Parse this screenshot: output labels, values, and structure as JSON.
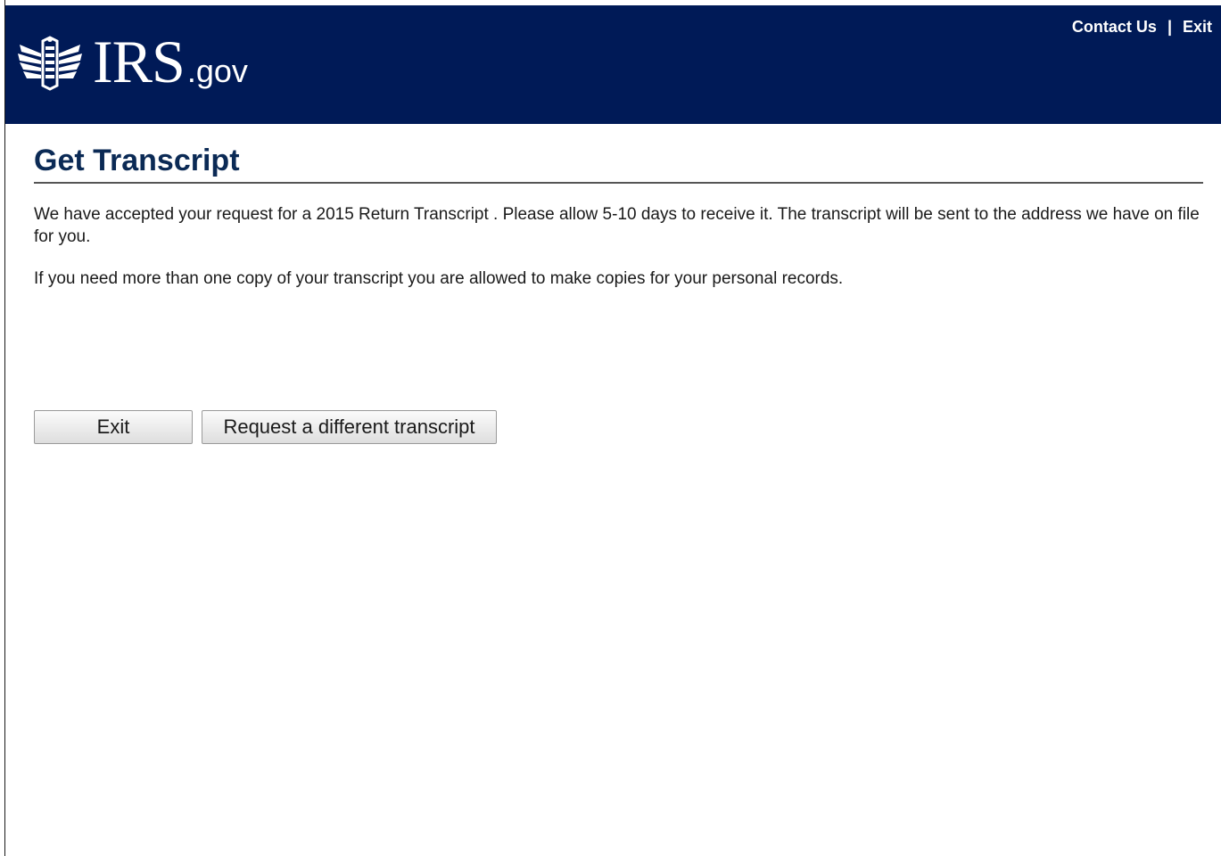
{
  "header": {
    "logo_text": "IRS",
    "logo_suffix": ".gov",
    "logo_icon": "irs-eagle-seal-icon",
    "contact_link": "Contact Us",
    "separator": "|",
    "exit_link": "Exit",
    "background_color": "#001a57"
  },
  "main": {
    "title": "Get Transcript",
    "paragraph1": "We have accepted your request for a 2015 Return Transcript . Please allow 5-10 days to receive it. The transcript will be sent to the address we have on file for you.",
    "paragraph2": "If you need more than one copy of your transcript you are allowed to make copies for your personal records."
  },
  "buttons": {
    "exit_label": "Exit",
    "request_label": "Request a different transcript"
  }
}
